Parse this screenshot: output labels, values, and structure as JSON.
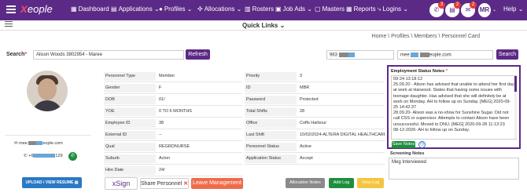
{
  "nav": {
    "logo_text": "eople",
    "items": [
      {
        "label": "Dashboard"
      },
      {
        "label": "Applications"
      },
      {
        "label": "Profiles"
      },
      {
        "label": "Allocations"
      },
      {
        "label": "Rosters"
      },
      {
        "label": "Job Ads"
      },
      {
        "label": "Masters"
      },
      {
        "label": "Reports"
      },
      {
        "label": "Logins"
      }
    ],
    "badges": [
      "3",
      "2",
      "2"
    ],
    "user_initials": "MR",
    "help_label": "Help"
  },
  "quick_links": {
    "label": "Quick Links"
  },
  "breadcrumb": "Home \\ Profiles \\ Members \\ Personnel Card",
  "search": {
    "label": "Search",
    "required": "*",
    "value": "Alison Woods 3802954 - Maree",
    "refresh_label": "Refresh",
    "phone_value": "963",
    "email_value": "mee",
    "email_domain": "eople.com",
    "search_label": "Search"
  },
  "contact": {
    "email_prefix": "mee",
    "email_domain": "eople.com",
    "phone_prefix": "+6",
    "phone_suffix": "129"
  },
  "details_left": [
    {
      "key": "Personnel Type",
      "value": "Member"
    },
    {
      "key": "Gender",
      "value": "F"
    },
    {
      "key": "DOB",
      "value": "01/"
    },
    {
      "key": "YOE",
      "value": "0 TO 6 MONTHS"
    },
    {
      "key": "Employee ID",
      "value": "38"
    },
    {
      "key": "External ID",
      "value": "--"
    },
    {
      "key": "Qual",
      "value": "REGRDNURSE"
    },
    {
      "key": "Suburb",
      "value": "Acton"
    },
    {
      "key": "Hire Date",
      "value": "24/"
    }
  ],
  "details_right": [
    {
      "key": "Priority",
      "value": "3"
    },
    {
      "key": "ID",
      "value": "MBR"
    },
    {
      "key": "Password",
      "value": "Protected"
    },
    {
      "key": "Total Shifts",
      "value": "28"
    },
    {
      "key": "Office",
      "value": "Coffs Harbour"
    },
    {
      "key": "Last Shift",
      "value": "10/02/2024-ALTERA DIGITAL HEALTHCARE"
    },
    {
      "key": "Personnel Status",
      "value": "Active"
    },
    {
      "key": "Application Status",
      "value": "Accept"
    }
  ],
  "notes": {
    "title": "Employment Status Notes",
    "required": "*",
    "text": "09-24 13:18:12\n25.09.20 - Alison has advised that unable to attend her first day at work at Harwood. States that having some issues with teenage daughter. Has advised that she will definitely be at work on Monday. AH to follow up on Sunday. [MEG] 2020-09-25 14:42:37\n28.09.20- Alison was a no-show for Sunshine Sugar. Did not call CSS or supervisor. Attempts to contact Alison have been unsuccessful. Moved to DNU. [MEG] 2020-09-28 11:13:23\n08-12-2026- AH to follow up on Sunday.",
    "save_label": "Save Notes"
  },
  "screening": {
    "label": "Screening Notes",
    "value": "Meg Interviewed"
  },
  "actions": {
    "upload_label": "UPLOAD / VIEW RESUME",
    "xsign_label": "xSign",
    "share_label": "Share Personnel",
    "leave_label": "Leave Management",
    "alloc_notes_label": "Allocation Notes",
    "add_log_label": "Add Log",
    "view_log_label": "View Log"
  },
  "colors": {
    "brand": "#5b2a86",
    "accent": "#e0457b",
    "green": "#1e8e3e",
    "orange": "#ef6c4a",
    "yellow": "#f5c542",
    "grey": "#8a8a8a"
  }
}
